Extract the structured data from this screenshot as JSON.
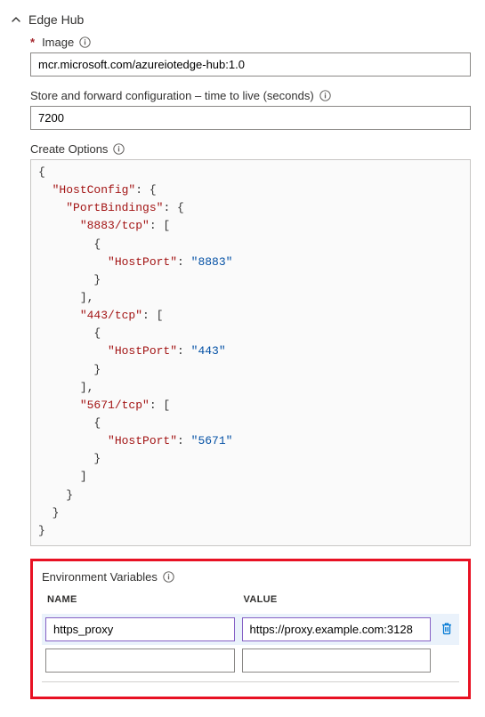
{
  "section": {
    "title": "Edge Hub"
  },
  "image": {
    "label": "Image",
    "value": "mcr.microsoft.com/azureiotedge-hub:1.0"
  },
  "ttl": {
    "label": "Store and forward configuration – time to live (seconds)",
    "value": "7200"
  },
  "createOptions": {
    "label": "Create Options"
  },
  "code": {
    "l1": "{",
    "l2a": "\"HostConfig\"",
    "l2b": ": {",
    "l3a": "\"PortBindings\"",
    "l3b": ": {",
    "l4a": "\"8883/tcp\"",
    "l4b": ": [",
    "l5": "{",
    "l6a": "\"HostPort\"",
    "l6b": ": ",
    "l6c": "\"8883\"",
    "l7": "}",
    "l8": "],",
    "l9a": "\"443/tcp\"",
    "l9b": ": [",
    "l10": "{",
    "l11a": "\"HostPort\"",
    "l11b": ": ",
    "l11c": "\"443\"",
    "l12": "}",
    "l13": "],",
    "l14a": "\"5671/tcp\"",
    "l14b": ": [",
    "l15": "{",
    "l16a": "\"HostPort\"",
    "l16b": ": ",
    "l16c": "\"5671\"",
    "l17": "}",
    "l18": "]",
    "l19": "}",
    "l20": "}",
    "l21": "}"
  },
  "env": {
    "sectionLabel": "Environment Variables",
    "headers": {
      "name": "NAME",
      "value": "VALUE"
    },
    "rows": [
      {
        "name": "https_proxy",
        "value": "https://proxy.example.com:3128"
      },
      {
        "name": "",
        "value": ""
      }
    ]
  }
}
